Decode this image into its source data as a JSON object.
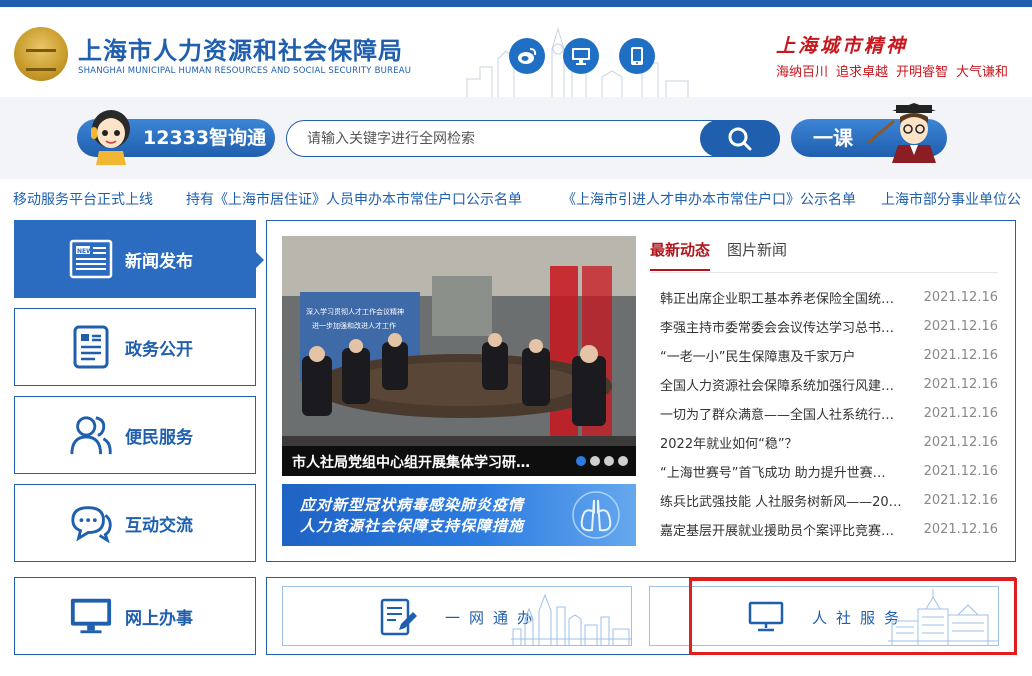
{
  "header": {
    "title_cn": "上海市人力资源和社会保障局",
    "title_en": "SHANGHAI MUNICIPAL HUMAN RESOURCES AND SOCIAL SECURITY BUREAU",
    "spirit_title": "上海城市精神",
    "spirit_phrases": [
      "海纳百川",
      "追求卓越",
      "开明睿智",
      "大气谦和"
    ]
  },
  "search": {
    "hotline_label": "12333智询通",
    "placeholder": "请输入关键字进行全网检索",
    "course_label": "一课"
  },
  "ticker": [
    "移动服务平台正式上线",
    "持有《上海市居住证》人员申办本市常住户口公示名单",
    "《上海市引进人才申办本市常住户口》公示名单",
    "上海市部分事业单位公"
  ],
  "nav": [
    {
      "label": "新闻发布",
      "icon": "news-icon"
    },
    {
      "label": "政务公开",
      "icon": "document-icon"
    },
    {
      "label": "便民服务",
      "icon": "people-icon"
    },
    {
      "label": "互动交流",
      "icon": "chat-icon"
    },
    {
      "label": "网上办事",
      "icon": "monitor-icon"
    }
  ],
  "feature": {
    "photo_caption": "市人社局党组中心组开展集体学习研…",
    "banner_line1": "应对新型冠状病毒感染肺炎疫情",
    "banner_line2": "人力资源社会保障支持保障措施"
  },
  "tabs": [
    "最新动态",
    "图片新闻"
  ],
  "news": [
    {
      "title": "韩正出席企业职工基本养老保险全国统…",
      "date": "2021.12.16"
    },
    {
      "title": "李强主持市委常委会会议传达学习总书…",
      "date": "2021.12.16"
    },
    {
      "title": "“一老一小”民生保障惠及千家万户",
      "date": "2021.12.16"
    },
    {
      "title": "全国人力资源社会保障系统加强行风建…",
      "date": "2021.12.16"
    },
    {
      "title": "一切为了群众满意——全国人社系统行…",
      "date": "2021.12.16"
    },
    {
      "title": "2022年就业如何“稳”？",
      "date": "2021.12.16"
    },
    {
      "title": "“上海世赛号”首飞成功 助力提升世赛…",
      "date": "2021.12.16"
    },
    {
      "title": "练兵比武强技能 人社服务树新风——20…",
      "date": "2021.12.16"
    },
    {
      "title": "嘉定基层开展就业援助员个案评比竞赛…",
      "date": "2021.12.16"
    }
  ],
  "services": [
    {
      "label": "一网通办",
      "icon": "form-edit-icon"
    },
    {
      "label": "人社服务",
      "icon": "monitor-icon"
    }
  ],
  "colors": {
    "brand": "#1f5fae",
    "accent_red": "#c8161d",
    "highlight": "#e11d1d"
  }
}
